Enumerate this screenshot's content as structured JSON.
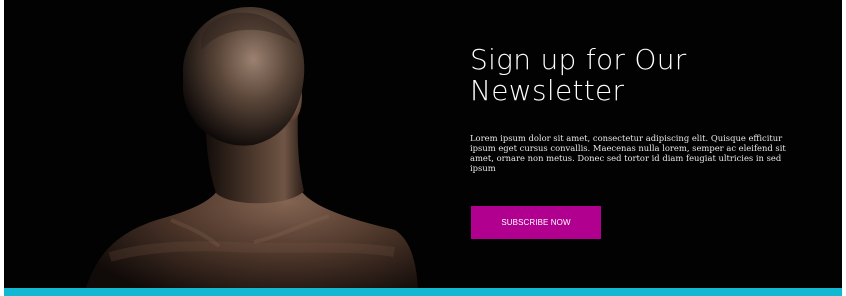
{
  "newsletter": {
    "title_line_1": "Sign up for Our",
    "title_line_2": "Newsletter",
    "description": "Lorem ipsum dolor sit amet, consectetur adipiscing elit. Quisque efficitur ipsum eget cursus convallis. Maecenas nulla lorem, semper ac eleifend sit amet, ornare non metus. Donec sed tortor id diam feugiat ultricies in sed ipsum",
    "button_label": "SUBSCRIBE NOW"
  },
  "colors": {
    "background": "#020202",
    "button": "#b1008f",
    "accent_bar": "#12b8d1",
    "text": "#ffffff"
  },
  "image": {
    "subject": "back of a man's head and shoulders"
  }
}
